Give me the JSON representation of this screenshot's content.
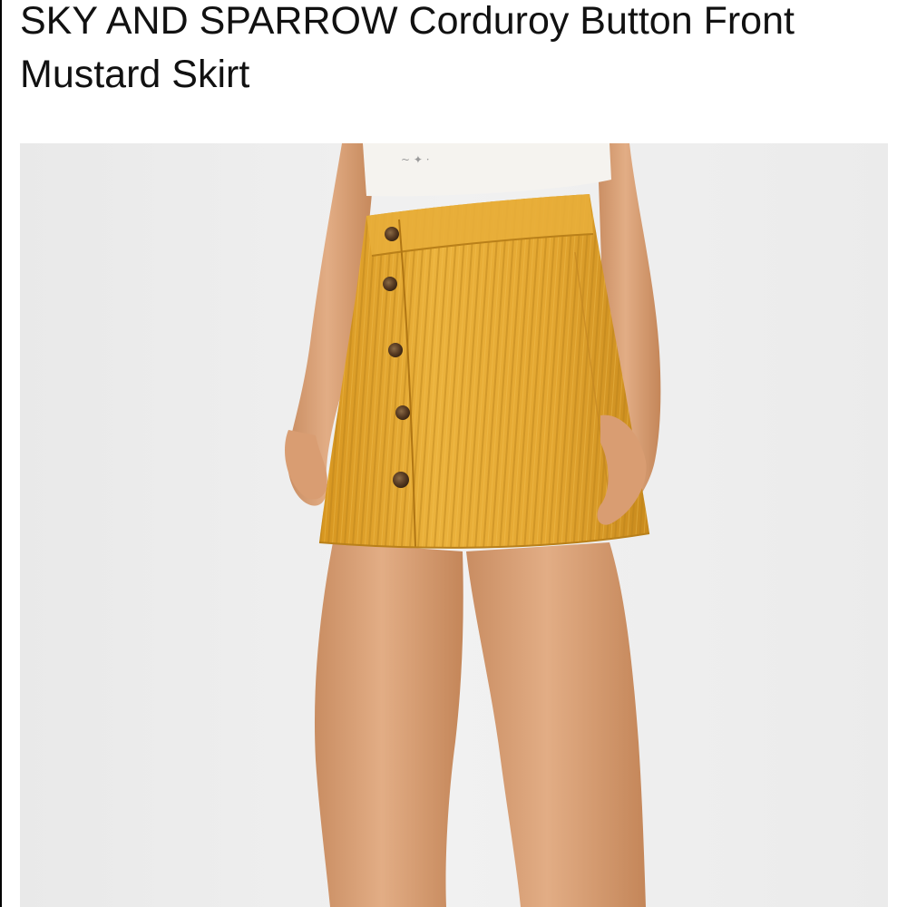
{
  "product": {
    "title": "SKY AND SPARROW Corduroy Button Front Mustard Skirt"
  },
  "image": {
    "subject": "mustard-corduroy-skirt",
    "colors": {
      "skirt": "#e5a831",
      "background": "#ededed",
      "shirt": "#f5f3ef",
      "buttons": "#5e4128"
    }
  }
}
